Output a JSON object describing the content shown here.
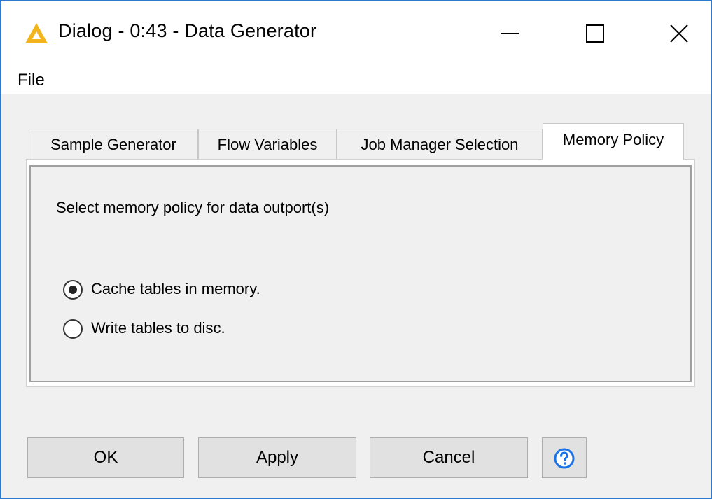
{
  "window": {
    "title": "Dialog - 0:43 - Data Generator",
    "controls": {
      "minimize": "minimize-icon",
      "maximize": "maximize-icon",
      "close": "close-icon"
    }
  },
  "menu": {
    "items": [
      {
        "label": "File"
      }
    ]
  },
  "tabs": [
    {
      "label": "Sample Generator",
      "active": false
    },
    {
      "label": "Flow Variables",
      "active": false
    },
    {
      "label": "Job Manager Selection",
      "active": false
    },
    {
      "label": "Memory Policy",
      "active": true
    }
  ],
  "memory_policy": {
    "group_label": "Select memory policy for data outport(s)",
    "options": [
      {
        "label": "Cache tables in memory.",
        "selected": true
      },
      {
        "label": "Write tables to disc.",
        "selected": false
      }
    ]
  },
  "buttons": {
    "ok": "OK",
    "apply": "Apply",
    "cancel": "Cancel",
    "help_icon": "help-icon"
  },
  "colors": {
    "window_border": "#2b79d0",
    "app_icon": "#f2b51c",
    "help_icon": "#1a73e8"
  }
}
